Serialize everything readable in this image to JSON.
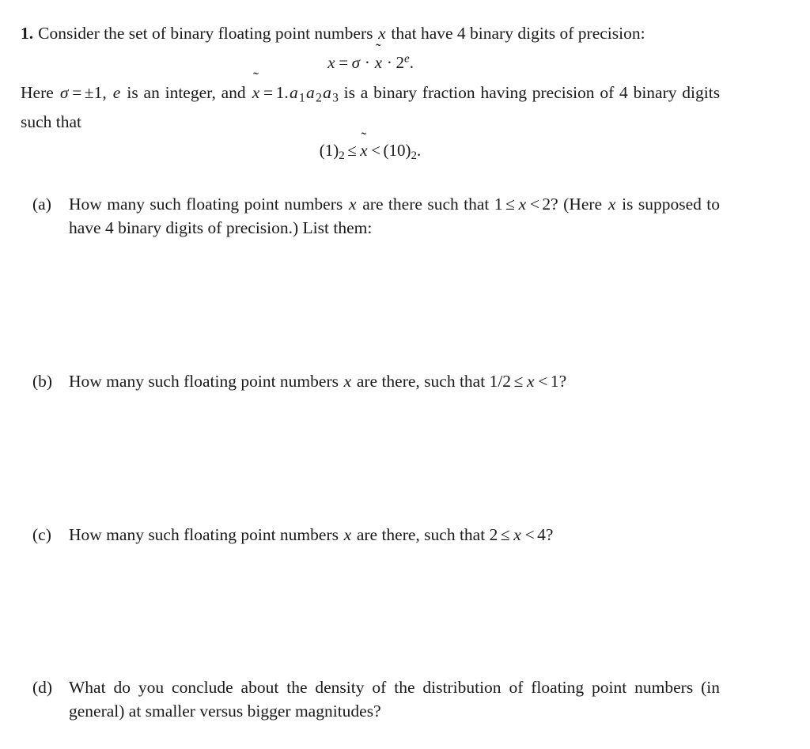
{
  "document": {
    "background_color": "#ffffff",
    "text_color": "#1a1a1a"
  },
  "problem": {
    "number": "1.",
    "stem_line1_part1": "Consider the set of binary floating point numbers",
    "stem_var_x": "x",
    "stem_line1_part2": "that have 4 binary digits of precision:",
    "equation1": {
      "lhs": "x",
      "eq": "=",
      "sigma": "σ",
      "dot1": "·",
      "x_tilde_base": "x",
      "x_tilde_accent": "˜",
      "dot2": "·",
      "base": "2",
      "exponent": "e",
      "period": "."
    },
    "stem2_here": "Here",
    "stem2_sigma": "σ",
    "stem2_eq": "=",
    "stem2_pm1": "±1",
    "stem2_comma": ",",
    "stem2_e": "e",
    "stem2_mid": "is an integer, and",
    "stem2_xtilde_base": "x",
    "stem2_xtilde_accent": "˜",
    "stem2_eq2": "=",
    "stem2_mantissa_int": "1.",
    "stem2_a": "a",
    "stem2_sub1": "1",
    "stem2_sub2": "2",
    "stem2_sub3": "3",
    "stem2_tail": "is a binary fraction having precision of 4 binary digits such that",
    "equation2": {
      "open1": "(",
      "one": "1",
      "close1": ")",
      "sub1": "2",
      "leq": "≤",
      "x_tilde_base": "x",
      "x_tilde_accent": "˜",
      "lt": "<",
      "open2": "(",
      "ten": "10",
      "close2": ")",
      "sub2": "2",
      "period": "."
    }
  },
  "parts": [
    {
      "label": "(a)",
      "text_before_math": "How many such floating point numbers",
      "var_x": "x",
      "text_mid": "are there such that",
      "math": {
        "lower": "1",
        "leq": "≤",
        "var": "x",
        "lt": "<",
        "upper": "2"
      },
      "question_mark": "?",
      "text_after": "(Here",
      "text_after_var": "x",
      "text_after_2": "is supposed to have 4 binary digits of precision.)  List them:"
    },
    {
      "label": "(b)",
      "text_before_math": "How many such floating point numbers",
      "var_x": "x",
      "text_mid": "are there, such that",
      "math": {
        "lower": "1/2",
        "leq": "≤",
        "var": "x",
        "lt": "<",
        "upper": "1"
      },
      "question_mark": "?",
      "text_after": "",
      "text_after_var": "",
      "text_after_2": ""
    },
    {
      "label": "(c)",
      "text_before_math": "How many such floating point numbers",
      "var_x": "x",
      "text_mid": "are there, such that",
      "math": {
        "lower": "2",
        "leq": "≤",
        "var": "x",
        "lt": "<",
        "upper": "4"
      },
      "question_mark": "?",
      "text_after": "",
      "text_after_var": "",
      "text_after_2": ""
    },
    {
      "label": "(d)",
      "text_before_math": "What do you conclude about the density of the distribution of floating point numbers (in general) at smaller versus bigger magnitudes?",
      "var_x": "",
      "text_mid": "",
      "math": null,
      "question_mark": "",
      "text_after": "",
      "text_after_var": "",
      "text_after_2": ""
    }
  ]
}
